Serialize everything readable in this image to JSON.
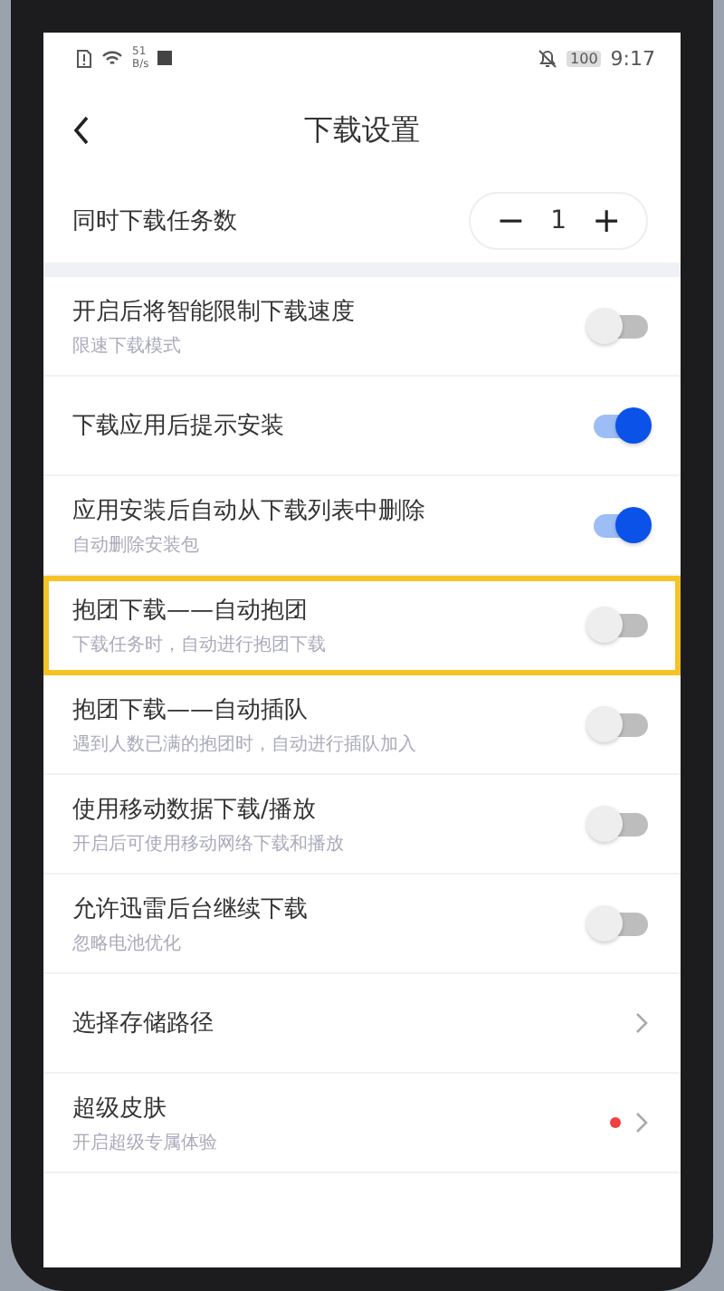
{
  "status_bar": {
    "speed_value": "51",
    "speed_unit": "B/s",
    "battery": "100",
    "time": "9:17"
  },
  "header": {
    "title": "下载设置"
  },
  "settings": [
    {
      "kind": "stepper",
      "label": "同时下载任务数",
      "value": "1",
      "minus": "−",
      "plus": "+"
    },
    {
      "kind": "toggle",
      "label": "开启后将智能限制下载速度",
      "hint": "限速下载模式",
      "on": false,
      "highlighted": false
    },
    {
      "kind": "toggle",
      "label": "下载应用后提示安装",
      "on": true,
      "highlighted": false
    },
    {
      "kind": "toggle",
      "label": "应用安装后自动从下载列表中删除",
      "hint": "自动删除安装包",
      "on": true,
      "highlighted": false
    },
    {
      "kind": "toggle",
      "label": "抱团下载——自动抱团",
      "hint": "下载任务时，自动进行抱团下载",
      "on": false,
      "highlighted": true
    },
    {
      "kind": "toggle",
      "label": "抱团下载——自动插队",
      "hint": "遇到人数已满的抱团时，自动进行插队加入",
      "on": false,
      "highlighted": false
    },
    {
      "kind": "toggle",
      "label": "使用移动数据下载/播放",
      "hint": "开启后可使用移动网络下载和播放",
      "on": false,
      "highlighted": false
    },
    {
      "kind": "toggle",
      "label": "允许迅雷后台继续下载",
      "hint": "忽略电池优化",
      "on": false,
      "highlighted": false
    },
    {
      "kind": "link",
      "label": "选择存储路径",
      "badge": false
    },
    {
      "kind": "link",
      "label": "超级皮肤",
      "hint": "开启超级专属体验",
      "badge": true
    }
  ]
}
